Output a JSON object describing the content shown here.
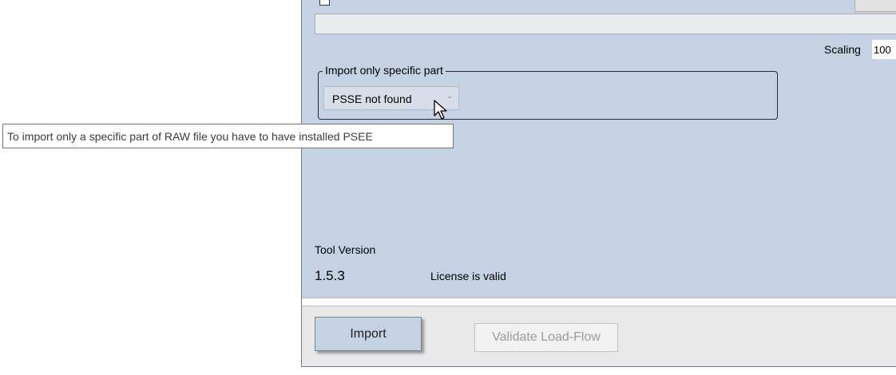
{
  "scaling": {
    "label": "Scaling",
    "value": "100"
  },
  "import_part": {
    "legend": "Import only specific part",
    "selected": "PSSE not found",
    "tooltip": "To import only a specific part of RAW file you have to have installed PSEE"
  },
  "tool": {
    "version_label": "Tool Version",
    "version": "1.5.3",
    "license_status": "License is valid"
  },
  "buttons": {
    "import": "Import",
    "validate": "Validate Load-Flow"
  },
  "icons": {
    "dropdown": "chevron-down-icon",
    "cursor": "mouse-pointer-icon"
  },
  "colors": {
    "panel": "#c5d2e4",
    "footer": "#e8e8e8"
  }
}
